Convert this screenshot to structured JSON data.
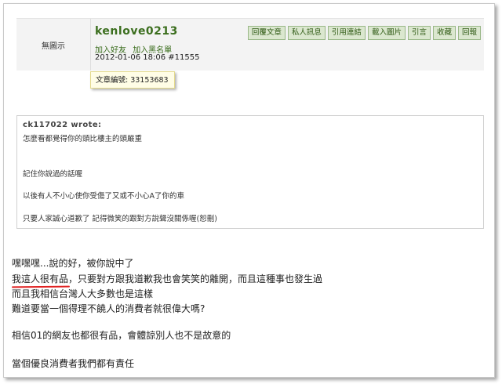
{
  "post": {
    "avatar_text": "無圖示",
    "username": "kenlove0213",
    "user_links": [
      "加入好友",
      "加入黑名單"
    ],
    "meta": "2012-01-06 18:06 #11555",
    "actions": [
      "回覆文章",
      "私人訊息",
      "引用連結",
      "載入圖片",
      "引言",
      "收藏",
      "回報"
    ],
    "article_id": "文章編號: 33153683"
  },
  "quote": {
    "author": "ck117022 wrote:",
    "lines": [
      "怎麼看都覺得你的頭比樓主的頭嚴重",
      "記住你說過的話喔",
      "以後有人不小心使你受傷了又或不小心A了你的車",
      "只要人家誠心道歉了 記得微笑的跟對方說聲沒關係喔(恕刪)"
    ]
  },
  "body": {
    "line1": "嘿嘿嘿...說的好，被你說中了",
    "line2_underlined": "我這人很有品",
    "line2_rest": "，只要對方跟我道歉我也會笑笑的離開，而且這種事也發生過",
    "line3": "而且我相信台灣人大多數也是這樣",
    "line4": "難道要當一個得理不饒人的消費者就很偉大嗎?",
    "line5": "相信01的網友也都很有品，會體諒別人也不是故意的",
    "line6": "當個優良消費者我們都有責任"
  }
}
